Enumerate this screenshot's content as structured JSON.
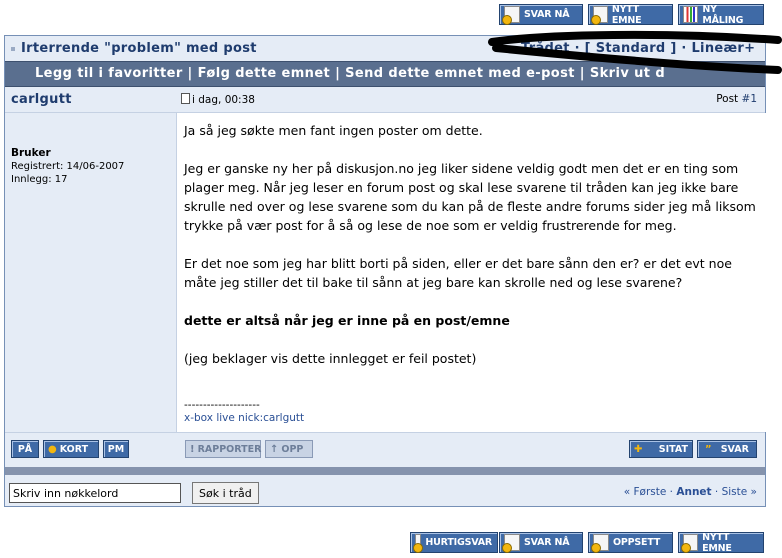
{
  "top_toolbar": {
    "reply_label": "SVAR NÅ",
    "new_topic_label": "NYTT EMNE",
    "new_poll_label": "NY MÅLING"
  },
  "thread": {
    "title": "Irterrende \"problem\" med post",
    "view_modes": "Trådet · [ Standard ] · Lineær+"
  },
  "thread_links": "Legg til i favoritter | Følg dette emnet | Send dette emnet med e-post | Skriv ut d",
  "post": {
    "author": "carlgutt",
    "date": "i dag, 00:38",
    "post_label": "Post",
    "post_number": "#1",
    "user_rank": "Bruker",
    "registered": "Registrert: 14/06-2007",
    "posts_count": "Innlegg: 17",
    "paragraphs": [
      "Ja så jeg søkte men fant ingen poster om dette.",
      "Jeg er ganske ny her på diskusjon.no jeg liker sidene veldig godt men det er en ting som plager meg. Når jeg leser en forum post og skal lese svarene til tråden kan jeg ikke bare skrulle ned over og lese svarene som du kan på de fleste andre forums sider jeg må liksom trykke på vær post for å så og lese de noe som er veldig frustrerende for meg.",
      "Er det noe som jeg har blitt borti på siden, eller er det bare sånn den er? er det evt noe måte jeg stiller det til bake til sånn at jeg bare kan skrolle ned og lese svarene?",
      "dette er altså når jeg er inne på en post/emne",
      "(jeg beklager vis dette innlegget er feil postet)"
    ],
    "sig_separator": "--------------------",
    "signature": "x-box live nick:carlgutt"
  },
  "post_buttons": {
    "pa": "PÅ",
    "kort": "KORT",
    "pm": "PM",
    "rapporter": "RAPPORTER",
    "opp": "OPP",
    "sitat": "SITAT",
    "svar": "SVAR"
  },
  "search": {
    "placeholder": "Skriv inn nøkkelord",
    "button": "Søk i tråd"
  },
  "pager": {
    "first": "« Første",
    "current": "Annet",
    "last": "Siste »"
  },
  "bottom_toolbar": {
    "quick_reply_label": "HURTIGSVAR",
    "reply_label": "SVAR NÅ",
    "setup_label": "OPPSETT",
    "new_topic_label": "NYTT EMNE"
  },
  "colors": {
    "button_blue": "#3f6aa6",
    "panel_bg": "#e5ecf6",
    "link_bar": "#5a6f8f",
    "title_text": "#1f3c6e"
  }
}
